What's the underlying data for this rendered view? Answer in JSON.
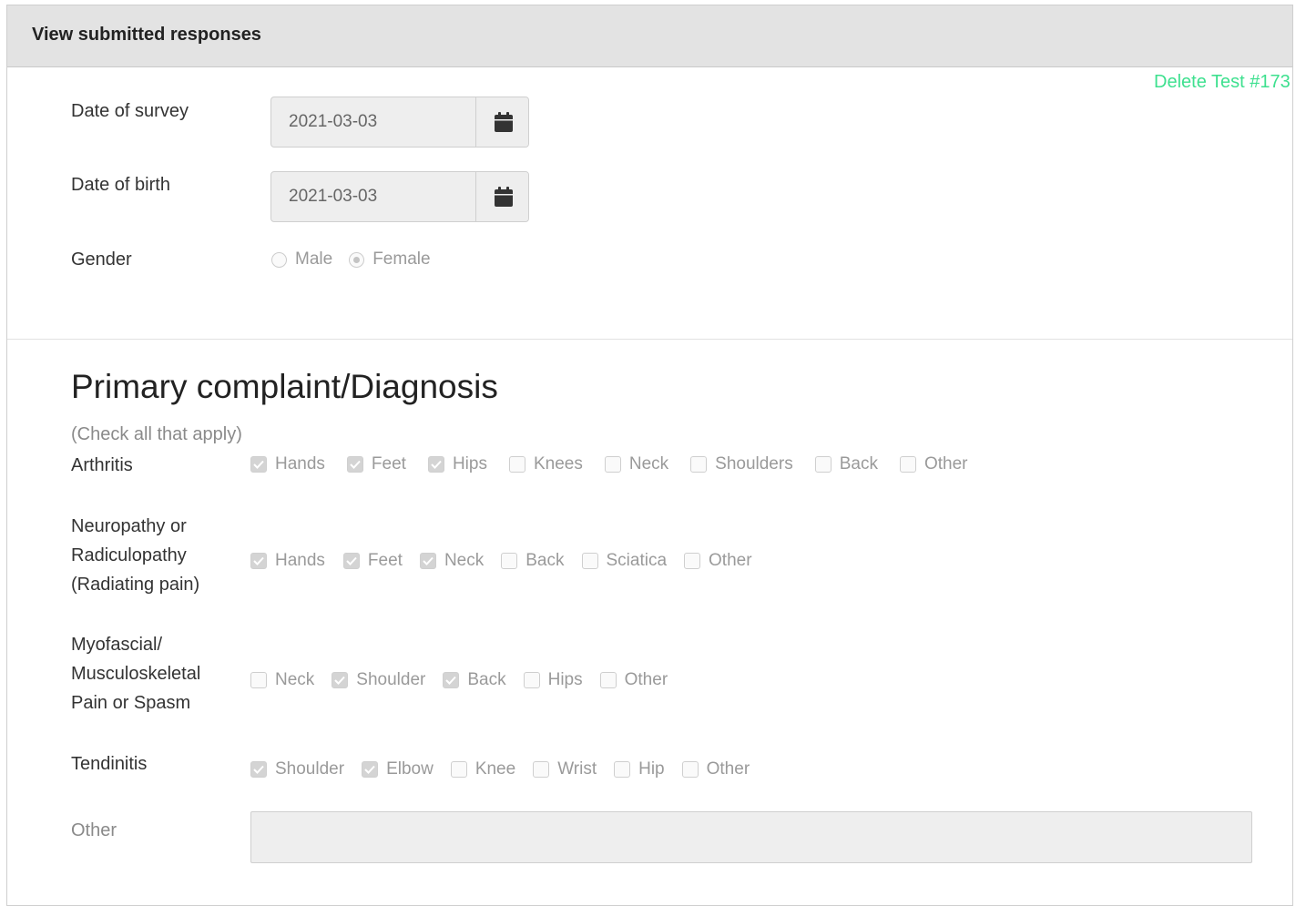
{
  "panel": {
    "title": "View submitted responses",
    "delete_link": "Delete Test #173"
  },
  "form": {
    "date_of_survey": {
      "label": "Date of survey",
      "value": "2021-03-03"
    },
    "date_of_birth": {
      "label": "Date of birth",
      "value": "2021-03-03"
    },
    "gender": {
      "label": "Gender",
      "options": [
        {
          "label": "Male",
          "checked": false
        },
        {
          "label": "Female",
          "checked": true
        }
      ]
    }
  },
  "diagnosis": {
    "title": "Primary complaint/Diagnosis",
    "hint": "(Check all that apply)",
    "groups": [
      {
        "label_lines": [
          "Arthritis"
        ],
        "options": [
          {
            "label": "Hands",
            "checked": true
          },
          {
            "label": "Feet",
            "checked": true
          },
          {
            "label": "Hips",
            "checked": true
          },
          {
            "label": "Knees",
            "checked": false
          },
          {
            "label": "Neck",
            "checked": false
          },
          {
            "label": "Shoulders",
            "checked": false
          },
          {
            "label": "Back",
            "checked": false
          },
          {
            "label": "Other",
            "checked": false
          }
        ]
      },
      {
        "label_lines": [
          "Neuropathy or",
          "Radiculopathy",
          "(Radiating pain)"
        ],
        "options": [
          {
            "label": "Hands",
            "checked": true
          },
          {
            "label": "Feet",
            "checked": true
          },
          {
            "label": "Neck",
            "checked": true
          },
          {
            "label": "Back",
            "checked": false
          },
          {
            "label": "Sciatica",
            "checked": false
          },
          {
            "label": "Other",
            "checked": false
          }
        ]
      },
      {
        "label_lines": [
          "Myofascial/",
          "Musculoskeletal",
          "Pain or Spasm"
        ],
        "options": [
          {
            "label": "Neck",
            "checked": false
          },
          {
            "label": "Shoulder",
            "checked": true
          },
          {
            "label": "Back",
            "checked": true
          },
          {
            "label": "Hips",
            "checked": false
          },
          {
            "label": "Other",
            "checked": false
          }
        ]
      },
      {
        "label_lines": [
          "Tendinitis"
        ],
        "options": [
          {
            "label": "Shoulder",
            "checked": true
          },
          {
            "label": "Elbow",
            "checked": true
          },
          {
            "label": "Knee",
            "checked": false
          },
          {
            "label": "Wrist",
            "checked": false
          },
          {
            "label": "Hip",
            "checked": false
          },
          {
            "label": "Other",
            "checked": false
          }
        ]
      }
    ],
    "other": {
      "label": "Other",
      "value": ""
    }
  },
  "icons": {
    "calendar": "calendar-icon",
    "check": "checkmark-icon"
  },
  "colors": {
    "delete_link": "#3ee08f",
    "header_bg": "#e3e3e3",
    "disabled_input_bg": "#eeeeee"
  }
}
